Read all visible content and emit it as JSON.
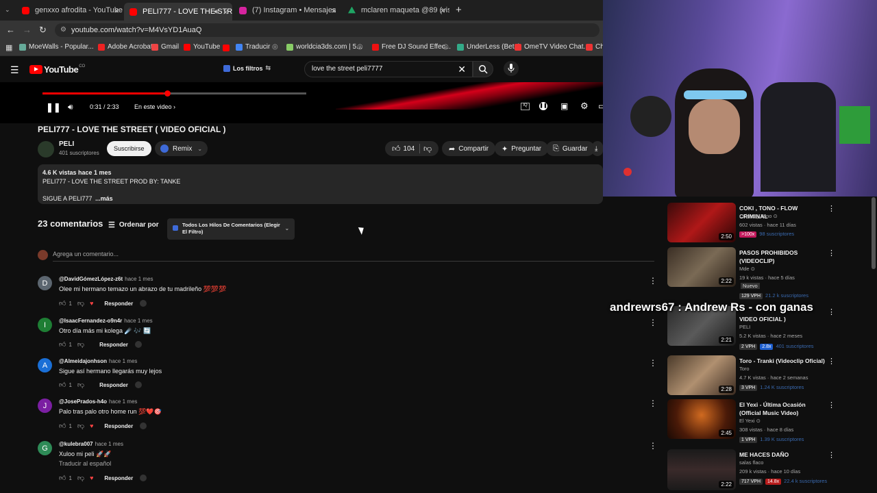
{
  "browser": {
    "tabs": [
      {
        "label": "genxxo afrodita - YouTube",
        "color": "#ff0000"
      },
      {
        "label": "PELI777 - LOVE THE STREET",
        "color": "#ff0000"
      },
      {
        "label": "(7) Instagram • Mensajes",
        "color": "#d6249f"
      },
      {
        "label": "mclaren maqueta @89 (visual)",
        "color": "#1fa463"
      }
    ],
    "new_tab": "+",
    "url": "youtube.com/watch?v=M4VsYD1AuaQ",
    "bookmarks": [
      "MoeWalls - Popular...",
      "Adobe Acrobat",
      "Gmail",
      "YouTube",
      "Traducir",
      "worldcia3ds.com | 5...",
      "Free DJ Sound Effec...",
      "UnderLess (Beta)",
      "OmeTV Video Chat...",
      "Ch"
    ]
  },
  "youtube": {
    "logo": "YouTube",
    "logo_sup": "CO",
    "filters_label": "Los filtros",
    "search_value": "love the street peli7777"
  },
  "player": {
    "time": "0:31 / 2:33",
    "chapters": "En este video",
    "progress": 0.07
  },
  "video": {
    "title": "PELI777 - LOVE THE STREET ( VIDEO OFICIAL )",
    "channel": "PELI",
    "subscribers": "401 suscriptores",
    "subscribe_label": "Suscribirse",
    "remix_label": "Remix",
    "likes": "104",
    "share_label": "Compartir",
    "ask_label": "Preguntar",
    "save_label": "Guardar",
    "desc_meta": "4.6 K vistas  hace 1 mes",
    "desc_line1": "PELI777 - LOVE THE STREET PROD BY: TANKE",
    "desc_line2": "SIGUE A PELI777",
    "desc_more": "...más"
  },
  "comments": {
    "count": "23 comentarios",
    "sort_label": "Ordenar por",
    "filter_label": "Todos Los Hilos De Comentarios (Elegir El Filtro)",
    "add_placeholder": "Agrega un comentario...",
    "reply_label": "Responder",
    "items": [
      {
        "avatar": "D",
        "avatar_color": "#5c6670",
        "author": "@DavidGómezLópez-z6t",
        "time": "hace 1 mes",
        "text": "Olee mi hermano temazo un abrazo de tu madrileño 💯💯💯",
        "likes": "1"
      },
      {
        "avatar": "I",
        "avatar_color": "#1e7e34",
        "author": "@IsaacFernandez-o9n4r",
        "time": "hace 1 mes",
        "text": "Otro día más mi kolega ☄️ 🎶 🔄",
        "likes": "1"
      },
      {
        "avatar": "A",
        "avatar_color": "#1a6fd6",
        "author": "@Almeidajonhson",
        "time": "hace 1 mes",
        "text": "Sigue así hermano llegarás muy lejos",
        "likes": "1"
      },
      {
        "avatar": "J",
        "avatar_color": "#7b1fa2",
        "author": "@JosePrados-h4o",
        "time": "hace 1 mes",
        "text": "Palo tras palo otro home run 💯❤️🎯",
        "likes": "1"
      },
      {
        "avatar": "G",
        "avatar_color": "#2e8b57",
        "author": "@kulebra007",
        "time": "hace 1 mes",
        "text": "Xuloo mi peli 🚀🚀",
        "translate": "Traducir al español",
        "likes": "1"
      }
    ]
  },
  "sidebar": {
    "items": [
      {
        "title": "COKI , TONO - FLOW CRIMINAL",
        "channel": "Coki ⊙ y Tono ⊙",
        "meta": "602 vistas · hace 11 días",
        "duration": "2:50",
        "badge": ">100x",
        "badge_color": "#c2185b",
        "subs": "98 suscriptores",
        "thumb_color": "#7a1c1c"
      },
      {
        "title": "PASOS PROHIBIDOS (VIDEOCLIP)",
        "channel": "Mde ⊙",
        "meta": "19 k vistas · hace 5 días",
        "extra": "Nuevo",
        "duration": "2:22",
        "badge": "129 VPH",
        "badge_color": "#333333",
        "subs": "21.2 k suscriptores",
        "thumb_color": "#5a4a3a"
      },
      {
        "title": "VIDEO OFICIAL )",
        "channel": "PELI",
        "meta": "5.2 K vistas · hace 2 meses",
        "duration": "2:21",
        "badge": "2 VPH",
        "badge_color": "#333333",
        "badge2": "2.8x",
        "subs": "401 suscriptores",
        "thumb_color": "#3a3a3a"
      },
      {
        "title": "Toro - Tranki (Videoclip Oficial)",
        "channel": "Toro",
        "meta": "4.7 K vistas · hace 2 semanas",
        "duration": "2:28",
        "badge": "3 VPH",
        "badge_color": "#333333",
        "subs": "1.24 K suscriptores",
        "thumb_color": "#8a7a6a"
      },
      {
        "title": "El Yexi - Última Ocasión (Official Music Video)",
        "channel": "El Yexi ⊙",
        "meta": "308 vistas · hace 8 días",
        "duration": "2:45",
        "badge": "1 VPH",
        "badge_color": "#333333",
        "subs": "1.39 K suscriptores",
        "thumb_color": "#5a2a10"
      },
      {
        "title": "ME HACES DAÑO",
        "channel": "salas flaco",
        "meta": "209 k vistas · hace 10 días",
        "duration": "2:22",
        "badge": "717 VPH",
        "badge_color": "#333333",
        "badge2": "14.8x",
        "subs": "22.4 k suscriptores",
        "thumb_color": "#3a2a2a"
      }
    ]
  },
  "stream_overlay": "andrewrs67 : Andrew Rs - con ganas"
}
